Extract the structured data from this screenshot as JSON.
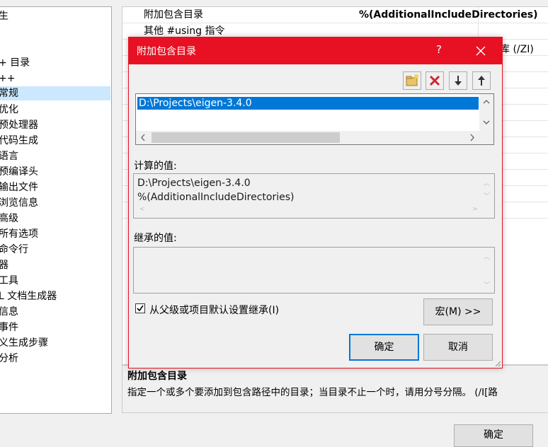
{
  "tree": {
    "items": [
      {
        "label": "生"
      },
      {
        "label": "+ 目录"
      },
      {
        "label": "++"
      },
      {
        "label": "常规",
        "selected": true
      },
      {
        "label": "优化"
      },
      {
        "label": "预处理器"
      },
      {
        "label": "代码生成"
      },
      {
        "label": "语言"
      },
      {
        "label": "预编译头"
      },
      {
        "label": "输出文件"
      },
      {
        "label": "浏览信息"
      },
      {
        "label": "高级"
      },
      {
        "label": "所有选项"
      },
      {
        "label": "命令行"
      },
      {
        "label": "器"
      },
      {
        "label": "工具"
      },
      {
        "label": "L 文档生成器"
      },
      {
        "label": "信息"
      },
      {
        "label": "事件"
      },
      {
        "label": "义生成步骤"
      },
      {
        "label": "分析"
      }
    ]
  },
  "grid": {
    "rows": [
      {
        "key": "附加包含目录",
        "value": "%(AdditionalIncludeDirectories)"
      },
      {
        "key": "其他 #using 指令",
        "value": ""
      }
    ],
    "partial_value": "库 (/ZI)"
  },
  "description": {
    "title": "附加包含目录",
    "text": "指定一个或多个要添加到包含路径中的目录；当目录不止一个时，请用分号分隔。     (/I[路"
  },
  "bottom_button": "确定",
  "dialog": {
    "title": "附加包含目录",
    "help": "?",
    "list_items": [
      "D:\\Projects\\eigen-3.4.0"
    ],
    "computed_label": "计算的值:",
    "computed_lines": [
      "D:\\Projects\\eigen-3.4.0",
      "%(AdditionalIncludeDirectories)"
    ],
    "inherited_label": "继承的值:",
    "inherit_checkbox_label": "从父级或项目默认设置继承(I)",
    "inherit_checked": true,
    "macro_button": "宏(M) >>",
    "ok_button": "确定",
    "cancel_button": "取消",
    "accent_color": "#e81123",
    "selection_color": "#0078d7"
  }
}
